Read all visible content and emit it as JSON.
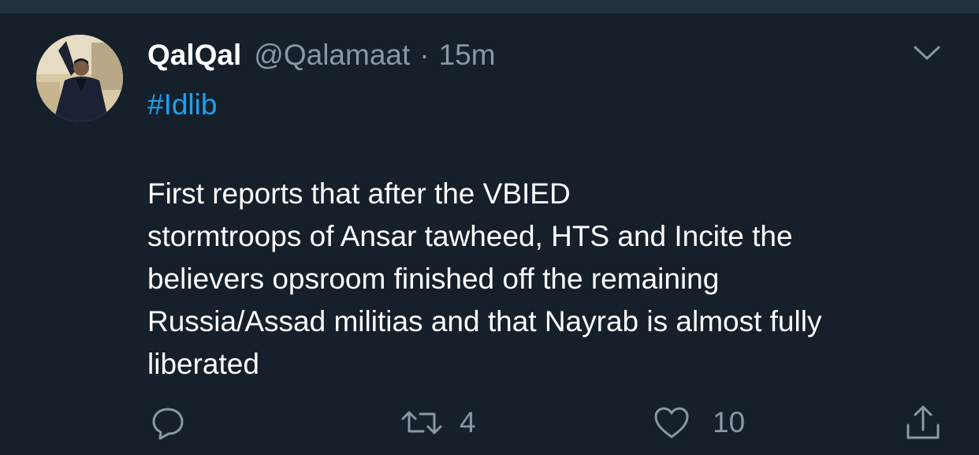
{
  "tweet": {
    "author": {
      "display_name": "QalQal",
      "handle": "@Qalamaat",
      "separator": "·",
      "time": "15m"
    },
    "hashtag": "#Idlib",
    "body_lines": [
      "First reports that after the VBIED",
      "stormtroops of Ansar tawheed, HTS and Incite the",
      "believers opsroom finished off the remaining",
      "Russia/Assad militias and that Nayrab is almost fully",
      "liberated"
    ],
    "actions": {
      "reply_icon": "reply-icon",
      "retweet_icon": "retweet-icon",
      "retweet_count": "4",
      "like_icon": "like-icon",
      "like_count": "10",
      "share_icon": "share-icon"
    },
    "more_icon": "chevron-down-icon"
  },
  "colors": {
    "background": "#15202b",
    "top_strip": "#253341",
    "text_primary": "#ffffff",
    "text_secondary": "#8899a6",
    "link": "#1da1f2"
  }
}
